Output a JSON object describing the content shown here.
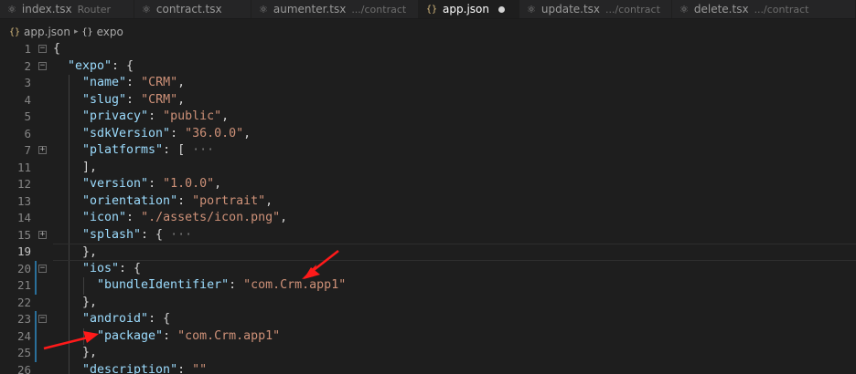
{
  "tabs": [
    {
      "label": "index.tsx",
      "description": "Router",
      "icon": "react-icon"
    },
    {
      "label": "contract.tsx",
      "description": "",
      "icon": "react-icon"
    },
    {
      "label": "aumenter.tsx",
      "description": ".../contract",
      "icon": "react-icon"
    },
    {
      "label": "app.json",
      "description": "",
      "icon": "json-icon",
      "active": true,
      "modified": true
    },
    {
      "label": "update.tsx",
      "description": ".../contract",
      "icon": "react-icon"
    },
    {
      "label": "delete.tsx",
      "description": ".../contract",
      "icon": "react-icon"
    }
  ],
  "breadcrumb": {
    "file": "app.json",
    "symbol": "expo",
    "file_icon": "{}",
    "symbol_icon": "{}"
  },
  "colors": {
    "key": "#9cdcfe",
    "string": "#ce9178",
    "punctuation": "#d4d4d4",
    "arrow": "#ff1a1a"
  },
  "lines": [
    {
      "n": "1",
      "fold": "minus",
      "indent": 0,
      "parts": [
        {
          "t": "p",
          "v": "{"
        }
      ]
    },
    {
      "n": "2",
      "fold": "minus",
      "indent": 1,
      "parts": [
        {
          "t": "k",
          "v": "\"expo\""
        },
        {
          "t": "p",
          "v": ": {"
        }
      ]
    },
    {
      "n": "3",
      "indent": 2,
      "parts": [
        {
          "t": "k",
          "v": "\"name\""
        },
        {
          "t": "p",
          "v": ": "
        },
        {
          "t": "s",
          "v": "\"CRM\""
        },
        {
          "t": "p",
          "v": ","
        }
      ]
    },
    {
      "n": "4",
      "indent": 2,
      "parts": [
        {
          "t": "k",
          "v": "\"slug\""
        },
        {
          "t": "p",
          "v": ": "
        },
        {
          "t": "s",
          "v": "\"CRM\""
        },
        {
          "t": "p",
          "v": ","
        }
      ]
    },
    {
      "n": "5",
      "indent": 2,
      "parts": [
        {
          "t": "k",
          "v": "\"privacy\""
        },
        {
          "t": "p",
          "v": ": "
        },
        {
          "t": "s",
          "v": "\"public\""
        },
        {
          "t": "p",
          "v": ","
        }
      ]
    },
    {
      "n": "6",
      "indent": 2,
      "parts": [
        {
          "t": "k",
          "v": "\"sdkVersion\""
        },
        {
          "t": "p",
          "v": ": "
        },
        {
          "t": "s",
          "v": "\"36.0.0\""
        },
        {
          "t": "p",
          "v": ","
        }
      ]
    },
    {
      "n": "7",
      "fold": "plus",
      "indent": 2,
      "parts": [
        {
          "t": "k",
          "v": "\"platforms\""
        },
        {
          "t": "p",
          "v": ": [ "
        },
        {
          "t": "e",
          "v": "···"
        }
      ]
    },
    {
      "n": "11",
      "indent": 2,
      "parts": [
        {
          "t": "p",
          "v": "],"
        }
      ]
    },
    {
      "n": "12",
      "indent": 2,
      "parts": [
        {
          "t": "k",
          "v": "\"version\""
        },
        {
          "t": "p",
          "v": ": "
        },
        {
          "t": "s",
          "v": "\"1.0.0\""
        },
        {
          "t": "p",
          "v": ","
        }
      ]
    },
    {
      "n": "13",
      "indent": 2,
      "parts": [
        {
          "t": "k",
          "v": "\"orientation\""
        },
        {
          "t": "p",
          "v": ": "
        },
        {
          "t": "s",
          "v": "\"portrait\""
        },
        {
          "t": "p",
          "v": ","
        }
      ]
    },
    {
      "n": "14",
      "indent": 2,
      "parts": [
        {
          "t": "k",
          "v": "\"icon\""
        },
        {
          "t": "p",
          "v": ": "
        },
        {
          "t": "s",
          "v": "\"./assets/icon.png\""
        },
        {
          "t": "p",
          "v": ","
        }
      ]
    },
    {
      "n": "15",
      "fold": "plus",
      "indent": 2,
      "parts": [
        {
          "t": "k",
          "v": "\"splash\""
        },
        {
          "t": "p",
          "v": ": { "
        },
        {
          "t": "e",
          "v": "···"
        }
      ]
    },
    {
      "n": "19",
      "indent": 2,
      "current": true,
      "parts": [
        {
          "t": "p",
          "v": "},"
        }
      ]
    },
    {
      "n": "20",
      "fold": "minus",
      "mod": true,
      "indent": 2,
      "parts": [
        {
          "t": "k",
          "v": "\"ios\""
        },
        {
          "t": "p",
          "v": ": {"
        }
      ]
    },
    {
      "n": "21",
      "mod": true,
      "indent": 3,
      "parts": [
        {
          "t": "k",
          "v": "\"bundleIdentifier\""
        },
        {
          "t": "p",
          "v": ": "
        },
        {
          "t": "s",
          "v": "\"com.Crm.app1\""
        }
      ]
    },
    {
      "n": "22",
      "indent": 2,
      "parts": [
        {
          "t": "p",
          "v": "},"
        }
      ]
    },
    {
      "n": "23",
      "fold": "minus",
      "mod": true,
      "indent": 2,
      "parts": [
        {
          "t": "k",
          "v": "\"android\""
        },
        {
          "t": "p",
          "v": ": {"
        }
      ]
    },
    {
      "n": "24",
      "mod": true,
      "indent": 3,
      "parts": [
        {
          "t": "k",
          "v": "\"package\""
        },
        {
          "t": "p",
          "v": ": "
        },
        {
          "t": "s",
          "v": "\"com.Crm.app1\""
        }
      ]
    },
    {
      "n": "25",
      "mod": true,
      "indent": 2,
      "parts": [
        {
          "t": "p",
          "v": "},"
        }
      ]
    },
    {
      "n": "26",
      "indent": 2,
      "parts": [
        {
          "t": "k",
          "v": "\"description\""
        },
        {
          "t": "p",
          "v": ": "
        },
        {
          "t": "s",
          "v": "\"\""
        }
      ]
    }
  ]
}
